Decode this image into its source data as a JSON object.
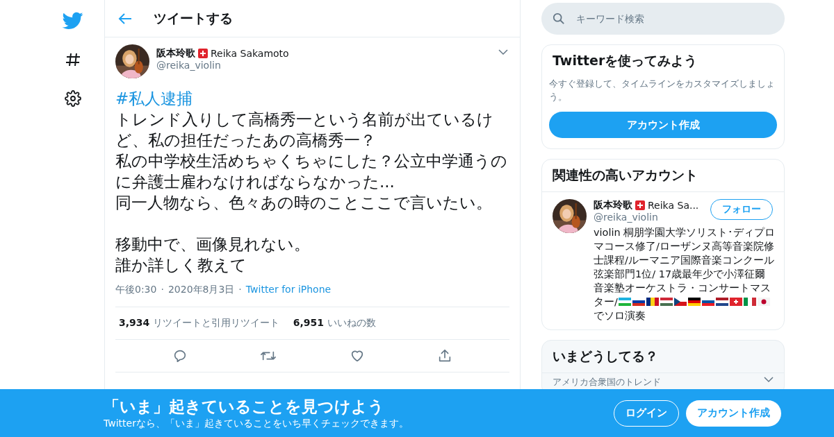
{
  "nav": {
    "items": [
      {
        "kind": "bird"
      },
      {
        "kind": "hash"
      },
      {
        "kind": "gear"
      }
    ]
  },
  "header": {
    "title": "ツイートする"
  },
  "tweet": {
    "author": {
      "name": "阪本玲歌",
      "name_latin": "Reika Sakamoto",
      "handle": "@reika_violin"
    },
    "hashtag": "#私人逮捕",
    "body": [
      [
        "トレンド入りして高橋秀一という名前が出ているけど、私の担任だったあの高橋秀一？",
        "私の中学校生活めちゃくちゃにした？公立中学通うのに弁護士雇わなければならなかった...",
        "同一人物なら、色々あの時のことここで言いたい。"
      ],
      [
        "移動中で、画像見れない。",
        "誰か詳しく教えて"
      ]
    ],
    "time": "午後0:30",
    "separator_1": "·",
    "date": "2020年8月3日",
    "separator_2": "·",
    "source": "Twitter for iPhone",
    "stats": [
      {
        "count": "3,934",
        "label": "リツイートと引用リツイート"
      },
      {
        "count": "6,951",
        "label": "いいねの数"
      }
    ],
    "actions": [
      {
        "kind": "reply"
      },
      {
        "kind": "retweet"
      },
      {
        "kind": "like"
      },
      {
        "kind": "share"
      }
    ]
  },
  "search": {
    "placeholder": "キーワード検索"
  },
  "signup_card": {
    "title": "Twitterを使ってみよう",
    "text": "今すぐ登録して、タイムラインをカスタマイズしましょう。",
    "button": "アカウント作成"
  },
  "related": {
    "title": "関連性の高いアカウント",
    "account": {
      "name": "阪本玲歌",
      "name_latin": "Reika Sa...",
      "handle": "@reika_violin",
      "follow": "フォロー",
      "bio_before": "violin 桐朋学園大学ソリスト･ディプロマコース修了/ローザンヌ高等音楽院修士課程/ルーマニア国際音楽コンクール弦楽部門1位/ 17歳最年少で小澤征爾音楽塾オーケストラ・コンサートマスター/",
      "flags": [
        {
          "kind": "uzbekistan"
        },
        {
          "kind": "russia"
        },
        {
          "kind": "romania"
        },
        {
          "kind": "hungary"
        },
        {
          "kind": "czech"
        },
        {
          "kind": "germany"
        },
        {
          "kind": "slovenia"
        },
        {
          "kind": "netherlands"
        },
        {
          "kind": "switzerland"
        },
        {
          "kind": "italy"
        },
        {
          "kind": "japan"
        }
      ],
      "bio_after": "でソロ演奏"
    }
  },
  "trends": {
    "title": "いまどうしてる？",
    "subtitle": "アメリカ合衆国のトレンド"
  },
  "banner": {
    "title": "「いま」起きていることを見つけよう",
    "text": "Twitterなら、「いま」起きていることをいち早くチェックできます。",
    "login": "ログイン",
    "signup": "アカウント作成"
  }
}
